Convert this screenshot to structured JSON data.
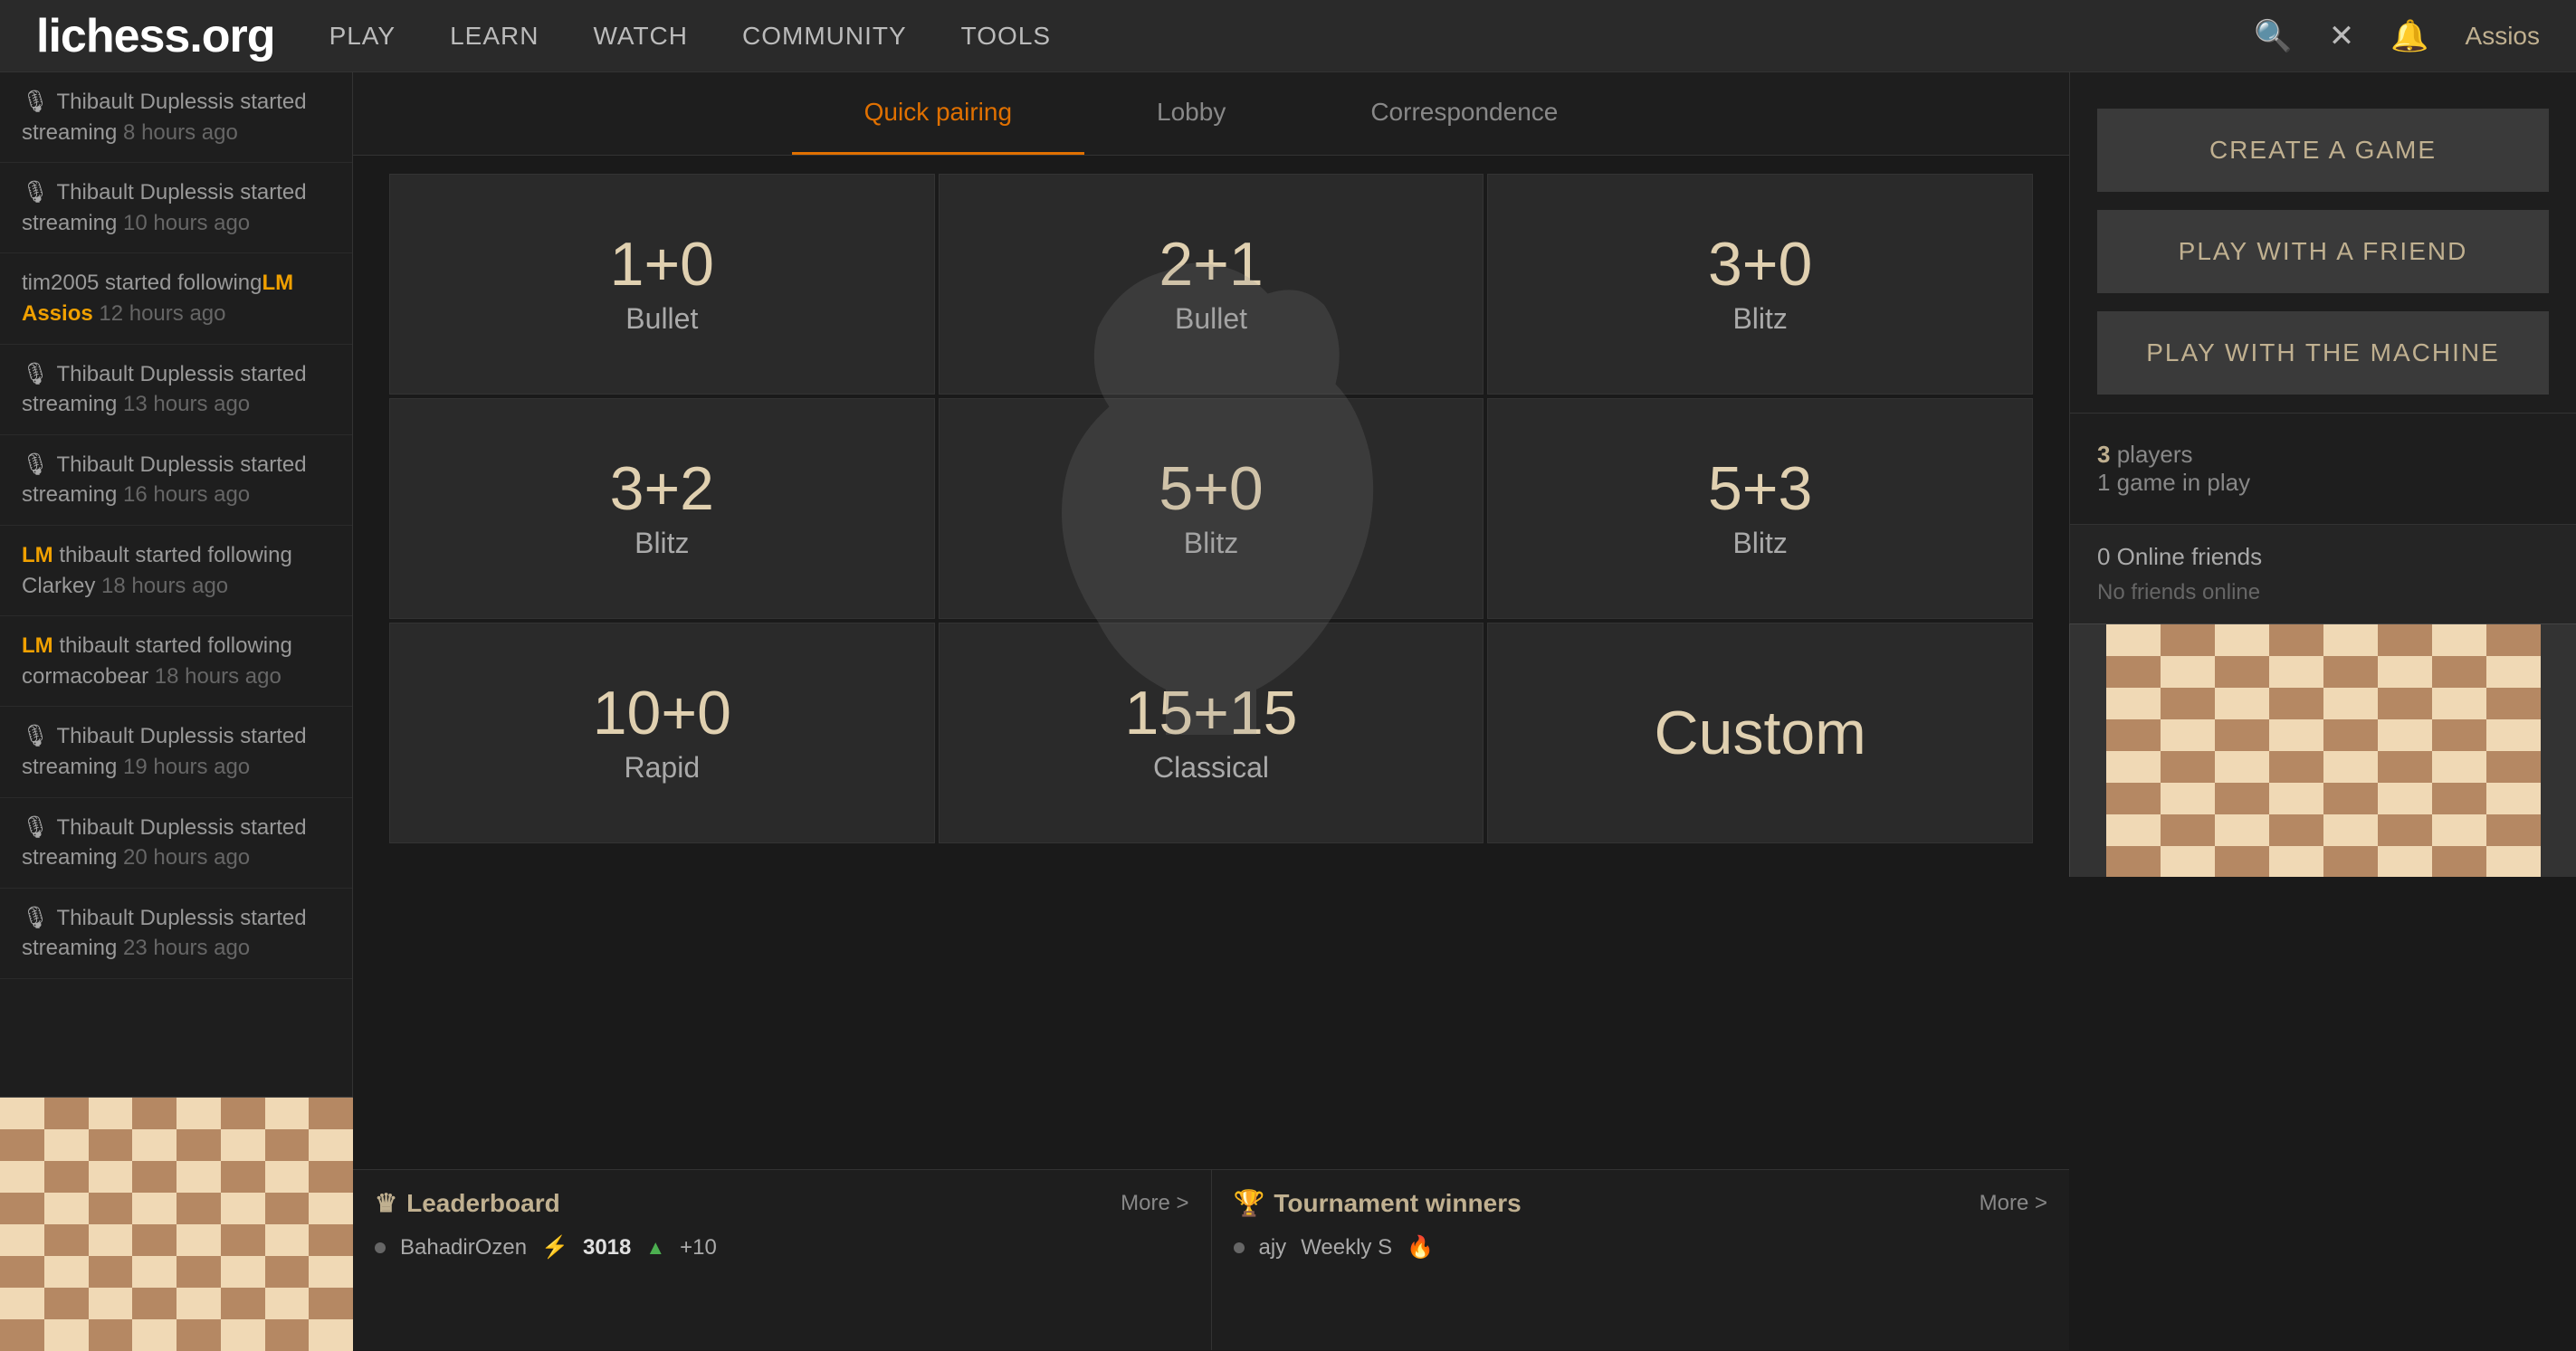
{
  "header": {
    "logo": "lichess.org",
    "nav": [
      {
        "label": "PLAY",
        "id": "play"
      },
      {
        "label": "LEARN",
        "id": "learn"
      },
      {
        "label": "WATCH",
        "id": "watch"
      },
      {
        "label": "COMMUNITY",
        "id": "community"
      },
      {
        "label": "TOOLS",
        "id": "tools"
      }
    ],
    "username": "Assios"
  },
  "tabs": [
    {
      "label": "Quick pairing",
      "id": "quick-pairing",
      "active": true
    },
    {
      "label": "Lobby",
      "id": "lobby",
      "active": false
    },
    {
      "label": "Correspondence",
      "id": "correspondence",
      "active": false
    }
  ],
  "pairingCells": [
    {
      "timeControl": "1+0",
      "gameType": "Bullet"
    },
    {
      "timeControl": "2+1",
      "gameType": "Bullet"
    },
    {
      "timeControl": "3+0",
      "gameType": "Blitz"
    },
    {
      "timeControl": "3+2",
      "gameType": "Blitz"
    },
    {
      "timeControl": "5+0",
      "gameType": "Blitz"
    },
    {
      "timeControl": "5+3",
      "gameType": "Blitz"
    },
    {
      "timeControl": "10+0",
      "gameType": "Rapid"
    },
    {
      "timeControl": "15+15",
      "gameType": "Classical"
    },
    {
      "timeControl": "Custom",
      "gameType": ""
    }
  ],
  "actionButtons": [
    {
      "label": "CREATE A GAME",
      "id": "create-game"
    },
    {
      "label": "PLAY WITH A FRIEND",
      "id": "play-friend"
    },
    {
      "label": "PLAY WITH THE MACHINE",
      "id": "play-machine"
    }
  ],
  "playersOnline": {
    "count": "3",
    "label": "players",
    "gamesLabel": "1 game in play"
  },
  "onlineFriends": {
    "header": "0 Online friends",
    "message": "No friends online"
  },
  "activityFeed": [
    {
      "icon": "mic",
      "text": "Thibault Duplessis started streaming",
      "time": "8 hours ago"
    },
    {
      "icon": "mic",
      "text": "Thibault Duplessis started streaming",
      "time": "10 hours ago"
    },
    {
      "icon": "",
      "text": "tim2005 started following",
      "highlight": "LM Assios",
      "time": "12 hours ago"
    },
    {
      "icon": "mic",
      "text": "Thibault Duplessis started streaming",
      "time": "13 hours ago"
    },
    {
      "icon": "mic",
      "text": "Thibault Duplessis started streaming",
      "time": "16 hours ago"
    },
    {
      "icon": "",
      "text": "LM thibault started following Clarkey",
      "time": "18 hours ago",
      "highlight": "LM"
    },
    {
      "icon": "",
      "text": "LM thibault started following cormacobear",
      "time": "18 hours ago",
      "highlight": "LM"
    },
    {
      "icon": "mic",
      "text": "Thibault Duplessis started streaming",
      "time": "19 hours ago"
    },
    {
      "icon": "mic",
      "text": "Thibault Duplessis started streaming",
      "time": "20 hours ago"
    },
    {
      "icon": "mic",
      "text": "Thibault Duplessis started streaming",
      "time": "23 hours ago"
    }
  ],
  "leaderboard": {
    "title": "Leaderboard",
    "moreLabel": "More >",
    "rows": [
      {
        "name": "BahadirOzen",
        "rating": "3018",
        "trend": "+10"
      }
    ]
  },
  "tournamentWinners": {
    "title": "Tournament winners",
    "moreLabel": "More >",
    "rows": [
      {
        "name": "ajy",
        "tournament": "Weekly S",
        "fire": true
      }
    ]
  }
}
